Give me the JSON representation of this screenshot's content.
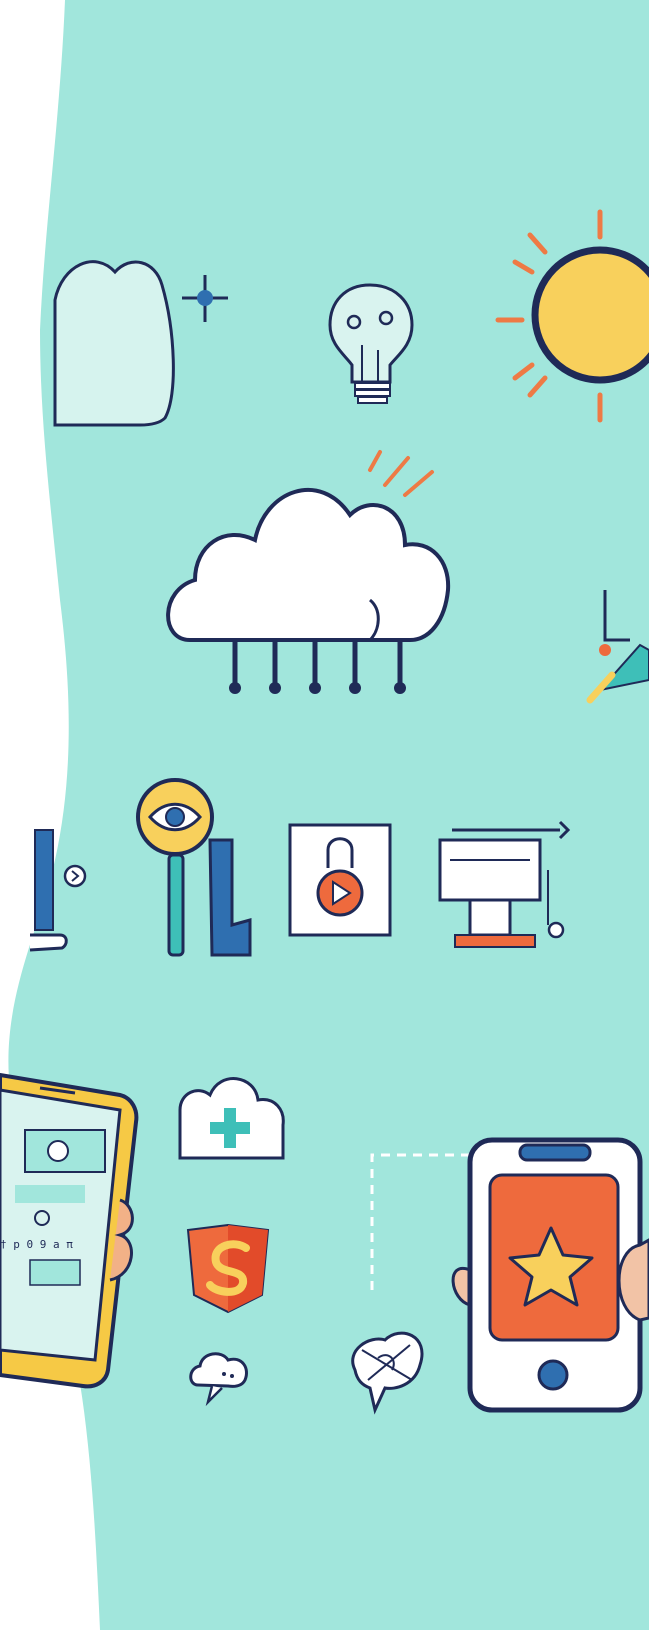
{
  "colors": {
    "background": "#a1e6dc",
    "outline": "#1f2a57",
    "sun_fill": "#f8d05c",
    "sun_rays": "#ee7a45",
    "phone_yellow": "#f6c945",
    "accent_orange": "#ee6a3d",
    "accent_blue": "#2f6fb0",
    "cloud_white": "#ffffff",
    "screen_light": "#d9f3ef",
    "teal_plus": "#3ebfb8"
  },
  "phone_left": {
    "screen_text": "† p 0 9 a π"
  },
  "icons": [
    "cloud-small-icon",
    "sparkle-icon",
    "lightbulb-icon",
    "sun-icon",
    "cloud-network-icon",
    "eye-key-icon",
    "lock-play-icon",
    "printer-icon",
    "phone-left-icon",
    "cloud-plus-icon",
    "shield-s-icon",
    "cloud-tiny-icon",
    "speech-bubble-icon",
    "phone-right-star-icon"
  ]
}
